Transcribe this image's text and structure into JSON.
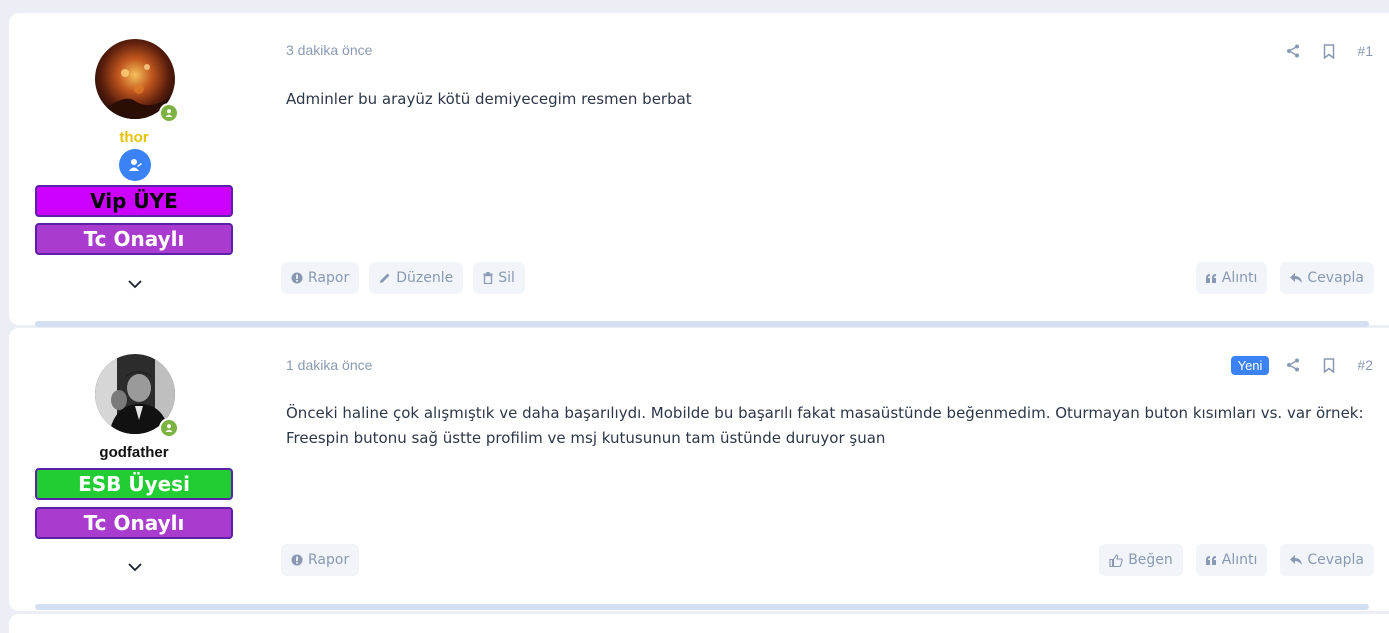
{
  "posts": [
    {
      "time": "3 dakika önce",
      "number": "#1",
      "new_label": "",
      "body": "Adminler bu arayüz kötü demiyecegim resmen berbat",
      "user": {
        "name": "thor",
        "name_color": "#e6c200",
        "badges": [
          {
            "label": "Vip ÜYE",
            "bg": "#cc00ff",
            "color": "#000000"
          },
          {
            "label": "Tc Onaylı",
            "bg": "#a93ccf",
            "color": "#ffffff"
          }
        ]
      },
      "left_buttons": [
        "Rapor",
        "Düzenle",
        "Sil"
      ],
      "right_buttons": [
        "Alıntı",
        "Cevapla"
      ]
    },
    {
      "time": "1 dakika önce",
      "number": "#2",
      "new_label": "Yeni",
      "body": "Önceki haline çok alışmıştık ve daha başarılıydı. Mobilde bu başarılı fakat masaüstünde beğenmedim. Oturmayan buton kısımları vs. var örnek: Freespin butonu sağ üstte profilim ve msj kutusunun tam üstünde duruyor şuan",
      "user": {
        "name": "godfather",
        "name_color": "#111111",
        "badges": [
          {
            "label": "ESB Üyesi",
            "bg": "#22cc33",
            "color": "#ffffff"
          },
          {
            "label": "Tc Onaylı",
            "bg": "#a93ccf",
            "color": "#ffffff"
          }
        ]
      },
      "left_buttons": [
        "Rapor"
      ],
      "right_buttons": [
        "Beğen",
        "Alıntı",
        "Cevapla"
      ]
    }
  ],
  "colors": {
    "accent": "#3b82f6",
    "muted_text": "#8a99b1",
    "online": "#7cb342",
    "divider": "#d3e0f1"
  },
  "icons": {
    "share": "share-icon",
    "bookmark": "bookmark-icon",
    "report": "info-circle-icon",
    "edit": "pencil-icon",
    "delete": "trash-icon",
    "quote": "quote-icon",
    "reply": "reply-icon",
    "like": "thumbs-up-icon",
    "expand": "chevron-down-icon"
  }
}
